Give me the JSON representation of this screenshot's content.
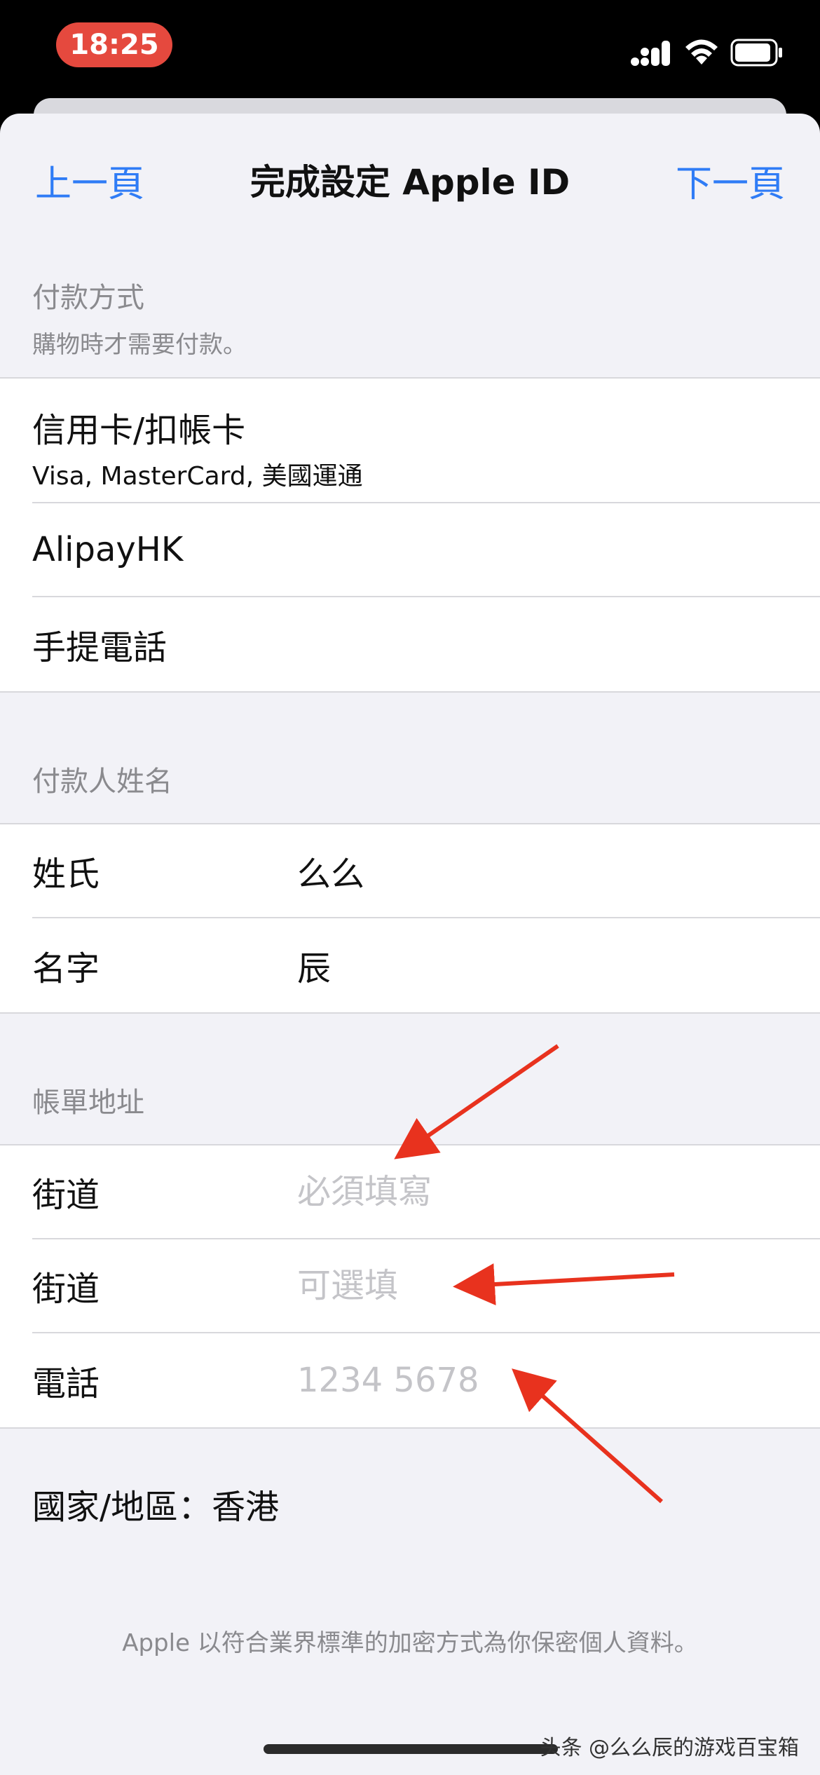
{
  "status_bar": {
    "time": "18:25",
    "icons": [
      "signal-icon",
      "wifi-icon",
      "battery-icon"
    ]
  },
  "nav": {
    "back_label": "上一頁",
    "title": "完成設定 Apple ID",
    "next_label": "下一頁"
  },
  "payment": {
    "header": "付款方式",
    "subheader": "購物時才需要付款。",
    "options": [
      {
        "label": "信用卡/扣帳卡",
        "sub": "Visa, MasterCard, 美國運通"
      },
      {
        "label": "AlipayHK"
      },
      {
        "label": "手提電話"
      }
    ]
  },
  "payer_name": {
    "header": "付款人姓名",
    "last_name_label": "姓氏",
    "last_name_value": "么么",
    "first_name_label": "名字",
    "first_name_value": "辰"
  },
  "billing": {
    "header": "帳單地址",
    "street1_label": "街道",
    "street1_placeholder": "必須填寫",
    "street2_label": "街道",
    "street2_placeholder": "可選填",
    "phone_label": "電話",
    "phone_placeholder": "1234 5678"
  },
  "country": "國家/地區：香港",
  "footer_note": "Apple 以符合業界標準的加密方式為你保密個人資料。",
  "watermark": "头条 @么么辰的游戏百宝箱",
  "colors": {
    "accent": "#2f7cf6",
    "time_pill": "#e5493e",
    "annotation_arrow": "#e8321e",
    "background": "#f2f2f7"
  }
}
